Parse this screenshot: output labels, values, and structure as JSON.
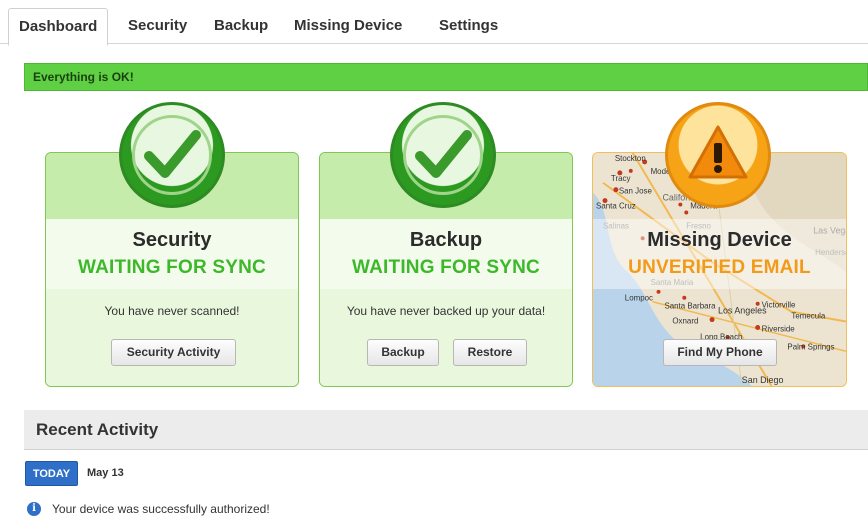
{
  "tabs": [
    {
      "label": "Dashboard",
      "active": true
    },
    {
      "label": "Security",
      "active": false
    },
    {
      "label": "Backup",
      "active": false
    },
    {
      "label": "Missing Device",
      "active": false
    },
    {
      "label": "Settings",
      "active": false
    }
  ],
  "status_bar": {
    "text": "Everything is OK!",
    "color": "#5fcf44"
  },
  "cards": {
    "security": {
      "title": "Security",
      "status": "WAITING FOR SYNC",
      "message": "You have never scanned!",
      "button": "Security Activity",
      "icon": "checkmark-icon"
    },
    "backup": {
      "title": "Backup",
      "status": "WAITING FOR SYNC",
      "message": "You have never backed up your data!",
      "buttons": {
        "backup": "Backup",
        "restore": "Restore"
      },
      "icon": "checkmark-icon"
    },
    "missing_device": {
      "title": "Missing Device",
      "status": "UNVERIFIED EMAIL",
      "button": "Find My Phone",
      "icon": "warning-icon",
      "map_labels": [
        "Stockton",
        "Modesto",
        "Tracy",
        "San Jose",
        "Santa Cruz",
        "Madera",
        "Fresno",
        "Salinas",
        "California",
        "Las Vegas",
        "Santa Maria",
        "Santa Barbara",
        "Lompoc",
        "Oxnard",
        "Los Angeles",
        "Long Beach",
        "Riverside",
        "Temecula",
        "Victorville",
        "Palm Springs",
        "Henderson",
        "San Diego"
      ]
    }
  },
  "recent_activity": {
    "title": "Recent Activity",
    "today_label": "TODAY",
    "date": "May 13",
    "items": [
      {
        "text": "Your device was successfully authorized!",
        "icon": "info-icon"
      }
    ]
  },
  "colors": {
    "success_green": "#3db82a",
    "warning_orange": "#f29b18",
    "today_blue": "#2f6fc7"
  }
}
